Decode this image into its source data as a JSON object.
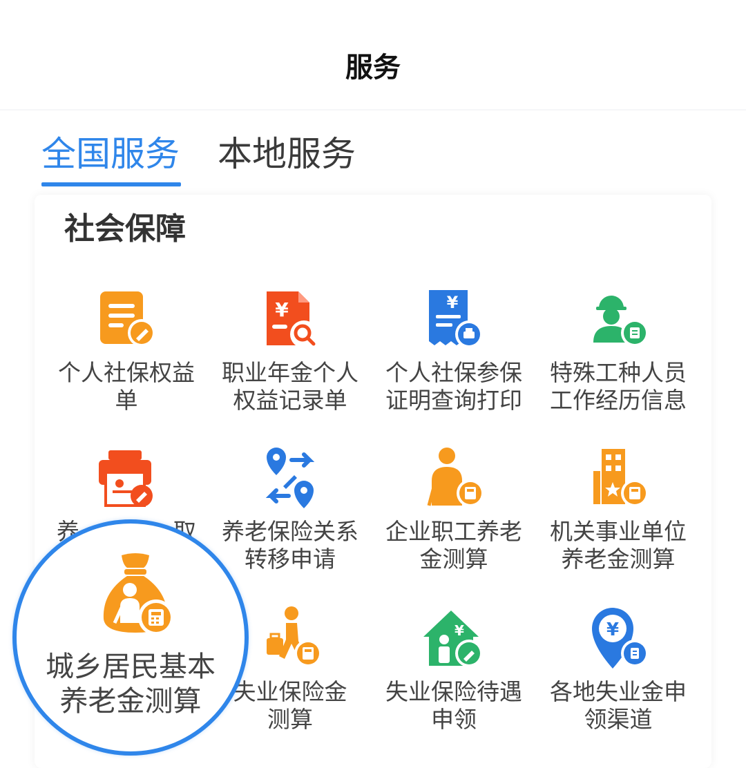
{
  "header": {
    "title": "服务"
  },
  "tabs": [
    {
      "label": "全国服务",
      "active": true
    },
    {
      "label": "本地服务",
      "active": false
    }
  ],
  "section": {
    "title": "社会保障"
  },
  "services": [
    {
      "line1": "个人社保权益",
      "line2": "单",
      "icon": "document-edit-icon"
    },
    {
      "line1": "职业年金个人",
      "line2": "权益记录单",
      "icon": "yuan-search-doc-icon"
    },
    {
      "line1": "个人社保参保",
      "line2": "证明查询打印",
      "icon": "receipt-print-icon"
    },
    {
      "line1": "特殊工种人员",
      "line2": "工作经历信息",
      "icon": "worker-record-icon"
    },
    {
      "line1": "养",
      "line2": "取",
      "icon": "printer-certificate-icon"
    },
    {
      "line1": "养老保险关系",
      "line2": "转移申请",
      "icon": "transfer-location-icon"
    },
    {
      "line1": "企业职工养老",
      "line2": "金测算",
      "icon": "elder-calculator-icon"
    },
    {
      "line1": "机关事业单位",
      "line2": "养老金测算",
      "icon": "building-calculator-icon"
    },
    {
      "line1": "失业保险金",
      "line2": "测算",
      "icon": "walker-calculator-icon"
    },
    {
      "line1": "失业保险待遇",
      "line2": "申领",
      "icon": "house-yuan-icon"
    },
    {
      "line1": "各地失业金申",
      "line2": "领渠道",
      "icon": "location-yuan-icon"
    }
  ],
  "highlight": {
    "line1": "城乡居民基本",
    "line2": "养老金测算",
    "icon": "money-bag-calculator-icon"
  },
  "colors": {
    "accent": "#2f86ea",
    "orange": "#f79a1e",
    "red": "#f24e1e",
    "green": "#2cb36a",
    "blue": "#2a79e0"
  }
}
